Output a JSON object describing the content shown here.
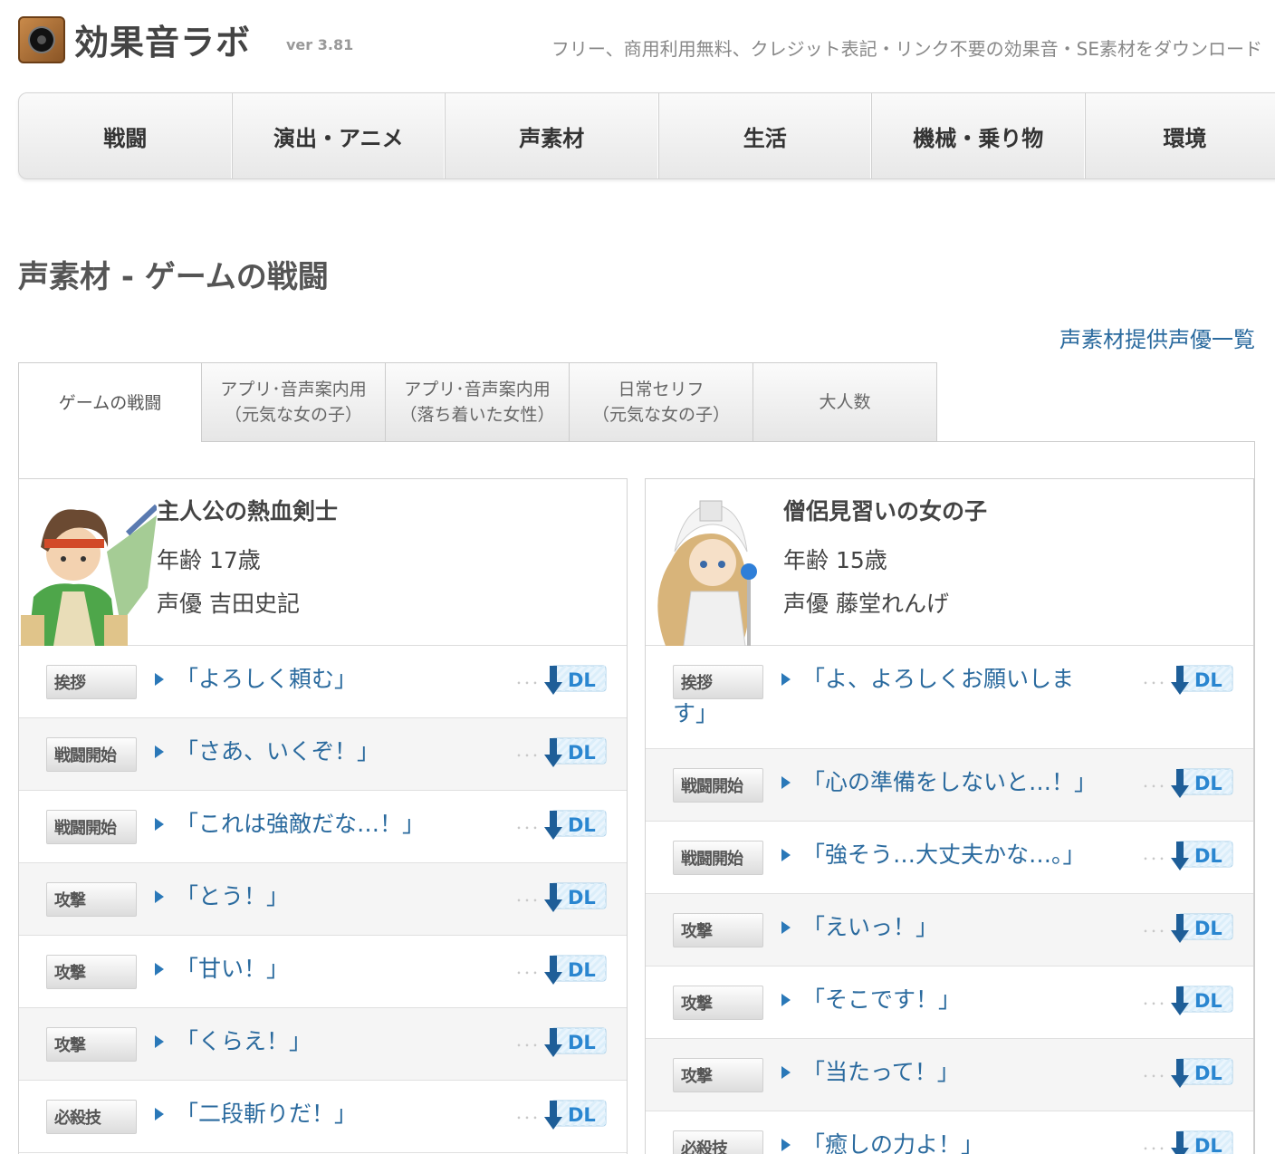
{
  "header": {
    "logo_text": "効果音ラボ",
    "version": "ver 3.81",
    "tagline": "フリー、商用利用無料、クレジット表記・リンク不要の効果音・SE素材をダウンロード"
  },
  "nav": {
    "items": [
      "戦闘",
      "演出・アニメ",
      "声素材",
      "生活",
      "機械・乗り物",
      "環境"
    ]
  },
  "page": {
    "title": "声素材 - ゲームの戦闘",
    "actor_link": "声素材提供声優一覧"
  },
  "tabs": [
    {
      "line1": "ゲームの戦闘",
      "line2": ""
    },
    {
      "line1": "アプリ･音声案内用",
      "line2": "（元気な女の子）"
    },
    {
      "line1": "アプリ･音声案内用",
      "line2": "（落ち着いた女性）"
    },
    {
      "line1": "日常セリフ",
      "line2": "（元気な女の子）"
    },
    {
      "line1": "大人数",
      "line2": ""
    }
  ],
  "characters": [
    {
      "name": "主人公の熱血剣士",
      "age": "年齢 17歳",
      "voice": "声優 吉田史記",
      "lines": [
        {
          "tag": "挨拶",
          "text": "「よろしく頼む」"
        },
        {
          "tag": "戦闘開始",
          "text": "「さあ、いくぞ！」"
        },
        {
          "tag": "戦闘開始",
          "text": "「これは強敵だな…！」"
        },
        {
          "tag": "攻撃",
          "text": "「とう！」"
        },
        {
          "tag": "攻撃",
          "text": "「甘い！」"
        },
        {
          "tag": "攻撃",
          "text": "「くらえ！」"
        },
        {
          "tag": "必殺技",
          "text": "「二段斬りだ！」"
        }
      ]
    },
    {
      "name": "僧侶見習いの女の子",
      "age": "年齢 15歳",
      "voice": "声優 藤堂れんげ",
      "lines": [
        {
          "tag": "挨拶",
          "text": "「よ、よろしくお願いします」"
        },
        {
          "tag": "戦闘開始",
          "text": "「心の準備をしないと…！」"
        },
        {
          "tag": "戦闘開始",
          "text": "「強そう…大丈夫かな…。」"
        },
        {
          "tag": "攻撃",
          "text": "「えいっ！」"
        },
        {
          "tag": "攻撃",
          "text": "「そこです！」"
        },
        {
          "tag": "攻撃",
          "text": "「当たって！」"
        },
        {
          "tag": "必殺技",
          "text": "「癒しの力よ！」"
        }
      ]
    }
  ],
  "dl_label": "DL",
  "dots": "･･･",
  "colors": {
    "link": "#2a6a9e",
    "play": "#2a78b8",
    "dl": "#3a8fd0"
  }
}
